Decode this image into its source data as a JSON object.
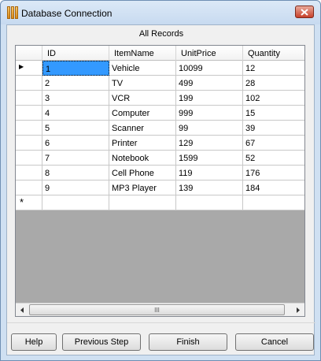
{
  "window": {
    "title": "Database Connection"
  },
  "caption": "All Records",
  "grid": {
    "columns": [
      "ID",
      "ItemName",
      "UnitPrice",
      "Quantity"
    ],
    "rows": [
      [
        "1",
        "Vehicle",
        "10099",
        "12"
      ],
      [
        "2",
        "TV",
        "499",
        "28"
      ],
      [
        "3",
        "VCR",
        "199",
        "102"
      ],
      [
        "4",
        "Computer",
        "999",
        "15"
      ],
      [
        "5",
        "Scanner",
        "99",
        "39"
      ],
      [
        "6",
        "Printer",
        "129",
        "67"
      ],
      [
        "7",
        "Notebook",
        "1599",
        "52"
      ],
      [
        "8",
        "Cell Phone",
        "119",
        "176"
      ],
      [
        "9",
        "MP3 Player",
        "139",
        "184"
      ]
    ],
    "new_row_marker": "*",
    "current_row_marker": "▶",
    "scroll_thumb_grip": "III"
  },
  "buttons": {
    "help": "Help",
    "previous": "Previous Step",
    "finish": "Finish",
    "cancel": "Cancel"
  },
  "icons": {
    "app": "database-app-icon",
    "close": "close-icon",
    "scroll_left": "arrow-left-icon",
    "scroll_right": "arrow-right-icon"
  },
  "colors": {
    "selection": "#3399ff",
    "close": "#c7402a"
  }
}
